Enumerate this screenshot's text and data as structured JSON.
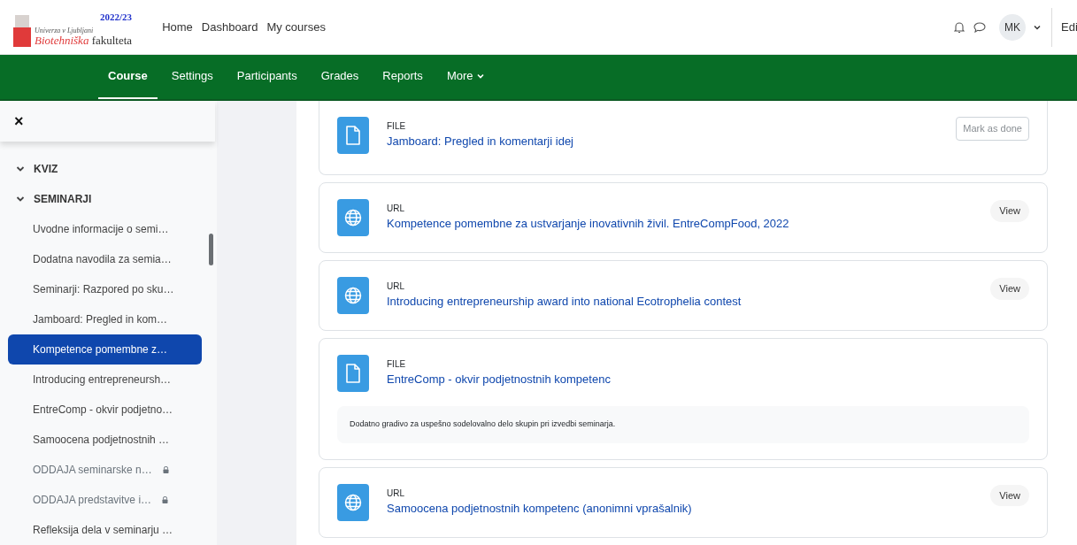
{
  "logo": {
    "university": "Univerza v Ljubljani",
    "faculty_highlight": "Biotehniška",
    "faculty_rest": "fakulteta",
    "year": "2022/23"
  },
  "top_nav": [
    "Home",
    "Dashboard",
    "My courses"
  ],
  "user": {
    "initials": "MK"
  },
  "edit_label": "Edi",
  "course_nav": [
    {
      "label": "Course",
      "selected": true,
      "dropdown": false
    },
    {
      "label": "Settings",
      "selected": false,
      "dropdown": false
    },
    {
      "label": "Participants",
      "selected": false,
      "dropdown": false
    },
    {
      "label": "Grades",
      "selected": false,
      "dropdown": false
    },
    {
      "label": "Reports",
      "selected": false,
      "dropdown": false
    },
    {
      "label": "More",
      "selected": false,
      "dropdown": true
    }
  ],
  "sidebar": {
    "close": "×",
    "sections": [
      {
        "title": "KVIZ",
        "expanded": true
      },
      {
        "title": "SEMINARJI",
        "expanded": true,
        "items": [
          {
            "label": "Uvodne informacije o semi…",
            "selected": false,
            "locked": false
          },
          {
            "label": "Dodatna navodila za semia…",
            "selected": false,
            "locked": false
          },
          {
            "label": "Seminarji: Razpored po sku…",
            "selected": false,
            "locked": false
          },
          {
            "label": "Jamboard: Pregled in kom…",
            "selected": false,
            "locked": false
          },
          {
            "label": "Kompetence pomembne z…",
            "selected": true,
            "locked": false
          },
          {
            "label": "Introducing entrepreneursh…",
            "selected": false,
            "locked": false
          },
          {
            "label": "EntreComp - okvir podjetno…",
            "selected": false,
            "locked": false
          },
          {
            "label": "Samoocena podjetnostnih …",
            "selected": false,
            "locked": false
          },
          {
            "label": "ODDAJA seminarske n…",
            "selected": false,
            "locked": true
          },
          {
            "label": "ODDAJA predstavitve i…",
            "selected": false,
            "locked": true
          },
          {
            "label": "Refleksija dela v seminarju …",
            "selected": false,
            "locked": false
          }
        ]
      }
    ]
  },
  "activities": [
    {
      "kind": "file",
      "type_label": "FILE",
      "title": "Jamboard: Pregled in komentarji idej",
      "button": {
        "kind": "outline",
        "label": "Mark as done"
      }
    },
    {
      "kind": "url",
      "type_label": "URL",
      "title": "Kompetence pomembne za ustvarjanje inovativnih živil. EntreCompFood, 2022",
      "button": {
        "kind": "pill",
        "label": "View"
      }
    },
    {
      "kind": "url",
      "type_label": "URL",
      "title": "Introducing entrepreneurship award into national Ecotrophelia contest",
      "button": {
        "kind": "pill",
        "label": "View"
      }
    },
    {
      "kind": "file",
      "type_label": "FILE",
      "title": "EntreComp - okvir podjetnostnih kompetenc",
      "description": "Dodatno gradivo za uspešno sodelovalno delo skupin pri izvedbi seminarja."
    },
    {
      "kind": "url",
      "type_label": "URL",
      "title": "Samoocena podjetnostnih kompetenc (anonimni vprašalnik)",
      "button": {
        "kind": "pill",
        "label": "View"
      }
    }
  ]
}
